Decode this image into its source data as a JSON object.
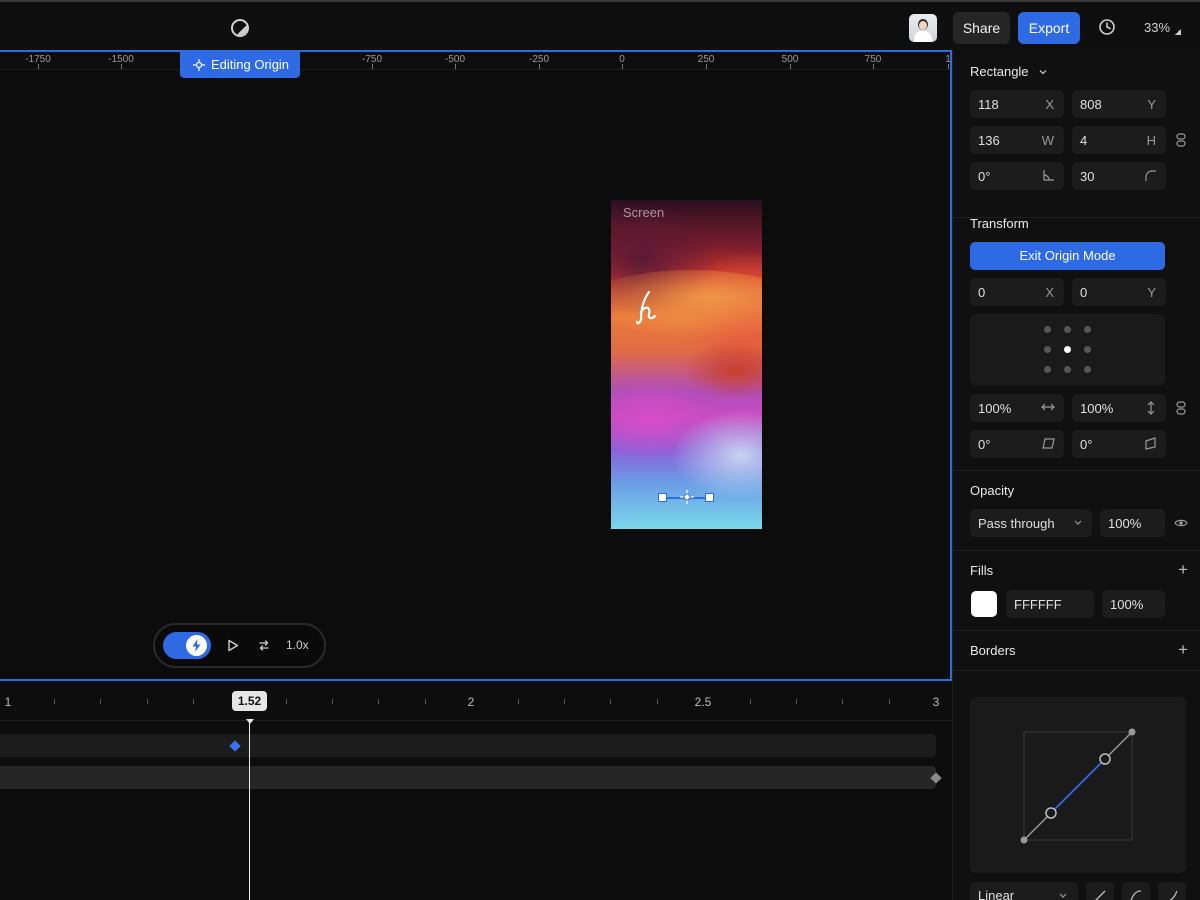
{
  "topbar": {
    "share_label": "Share",
    "export_label": "Export",
    "zoom": "33%"
  },
  "canvas": {
    "ruler_labels": [
      "-1750",
      "-1500",
      "-750",
      "-500",
      "-250",
      "0",
      "250",
      "500",
      "750",
      "1"
    ],
    "editing_origin_label": "Editing Origin",
    "screen_label": "Screen",
    "playbar": {
      "speed": "1.0x"
    }
  },
  "timeline": {
    "labels": [
      "1",
      "2",
      "2.5",
      "3"
    ],
    "current_time": "1.52"
  },
  "panel": {
    "element_type": "Rectangle",
    "x": "118",
    "x_suffix": "X",
    "y": "808",
    "y_suffix": "Y",
    "w": "136",
    "w_suffix": "W",
    "h": "4",
    "h_suffix": "H",
    "rotation": "0°",
    "radius": "30",
    "transform": {
      "title": "Transform",
      "exit_label": "Exit Origin Mode",
      "origin_x": "0",
      "origin_x_suffix": "X",
      "origin_y": "0",
      "origin_y_suffix": "Y",
      "scale_x": "100%",
      "scale_y": "100%",
      "skew_x": "0°",
      "skew_y": "0°"
    },
    "opacity": {
      "title": "Opacity",
      "blend_mode": "Pass through",
      "value": "100%"
    },
    "fills": {
      "title": "Fills",
      "color_hex": "FFFFFF",
      "swatch_color": "#FFFFFF",
      "opacity": "100%"
    },
    "borders": {
      "title": "Borders"
    },
    "easing": {
      "type": "Linear"
    }
  },
  "colors": {
    "accent": "#2F6AE5",
    "background": "#0D0D0D",
    "panel": "#101010"
  },
  "icons": [
    "theme-toggle-icon",
    "history-icon",
    "origin-crosshair-icon",
    "bolt-icon",
    "play-icon",
    "loop-icon",
    "chevron-down-icon",
    "constrain-proportions-icon",
    "rotation-icon",
    "corner-radius-icon",
    "eye-icon",
    "plus-icon"
  ]
}
